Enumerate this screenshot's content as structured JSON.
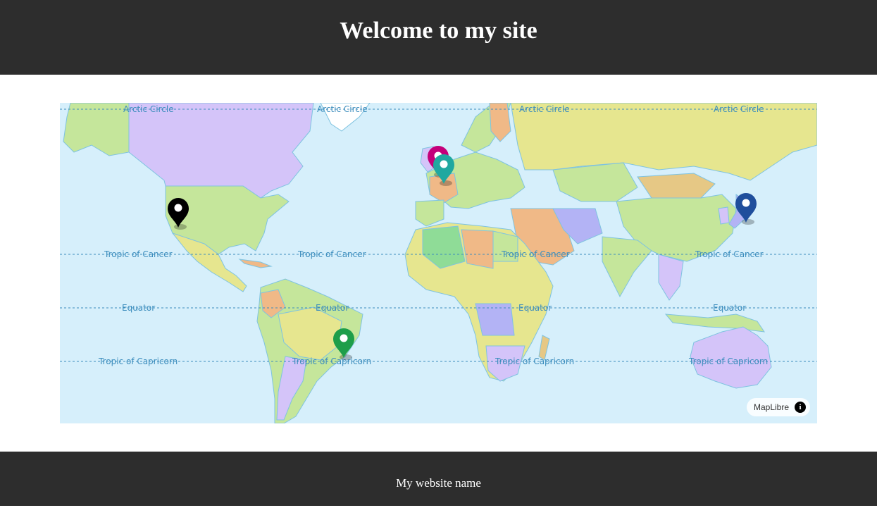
{
  "header": {
    "title": "Welcome to my site"
  },
  "footer": {
    "text": "My website name"
  },
  "map": {
    "attribution": "MapLibre",
    "info_icon": "info-icon",
    "water_color": "#d6effb",
    "line_labels": {
      "arctic": "Arctic Circle",
      "cancer": "Tropic of Cancer",
      "equator": "Equator",
      "capricorn": "Tropic of Capricorn"
    },
    "markers": [
      {
        "name": "marker-san-francisco",
        "color": "#000000"
      },
      {
        "name": "marker-london",
        "color": "#c4007a"
      },
      {
        "name": "marker-paris",
        "color": "#20a8a0"
      },
      {
        "name": "marker-tokyo",
        "color": "#1f4e9c"
      },
      {
        "name": "marker-rio",
        "color": "#1e9e4a"
      }
    ]
  }
}
